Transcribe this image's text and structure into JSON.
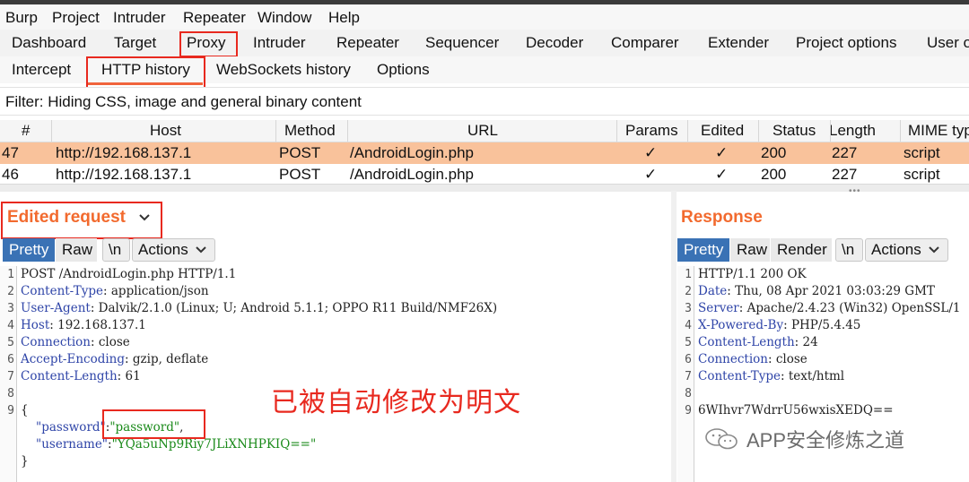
{
  "menubar": {
    "items": [
      "Burp",
      "Project",
      "Intruder",
      "Repeater",
      "Window",
      "Help"
    ]
  },
  "tabs": [
    "Dashboard",
    "Target",
    "Proxy",
    "Intruder",
    "Repeater",
    "Sequencer",
    "Decoder",
    "Comparer",
    "Extender",
    "Project options",
    "User o"
  ],
  "subtabs": [
    "Intercept",
    "HTTP history",
    "WebSockets history",
    "Options"
  ],
  "filter": {
    "text": "Filter: Hiding CSS, image and general binary content"
  },
  "table": {
    "columns": [
      "#",
      "Host",
      "Method",
      "URL",
      "Params",
      "Edited",
      "Status",
      "Length",
      "MIME typ"
    ],
    "rows": [
      {
        "num": "47",
        "host": "http://192.168.137.1",
        "method": "POST",
        "url": "/AndroidLogin.php",
        "params": "✓",
        "edited": "✓",
        "status": "200",
        "length": "227",
        "mime": "script"
      },
      {
        "num": "46",
        "host": "http://192.168.137.1",
        "method": "POST",
        "url": "/AndroidLogin.php",
        "params": "✓",
        "edited": "✓",
        "status": "200",
        "length": "227",
        "mime": "script"
      }
    ]
  },
  "request": {
    "title": "Edited request",
    "buttons": {
      "pretty": "Pretty",
      "raw": "Raw",
      "newline": "\\n",
      "actions": "Actions"
    },
    "line_numbers": [
      "1",
      "2",
      "3",
      "4",
      "5",
      "6",
      "7",
      "8",
      "9"
    ],
    "lines": {
      "l1": "POST /AndroidLogin.php HTTP/1.1",
      "l2_name": "Content-Type",
      "l2_value": " application/json",
      "l3_name": "User-Agent",
      "l3_value": " Dalvik/2.1.0 (Linux; U; Android 5.1.1; OPPO R11 Build/NMF26X)",
      "l4_name": "Host",
      "l4_value": " 192.168.137.1",
      "l5_name": "Connection",
      "l5_value": " close",
      "l6_name": "Accept-Encoding",
      "l6_value": " gzip, deflate",
      "l7_name": "Content-Length",
      "l7_value": " 61",
      "l9": "{",
      "json_key1": "\"password\"",
      "json_val1": "\"password\"",
      "json_key2": "\"username\"",
      "json_val2": "\"YQa5uNp9Riy7JLiXNHPKIQ==\"",
      "close": "}"
    }
  },
  "response": {
    "title": "Response",
    "buttons": {
      "pretty": "Pretty",
      "raw": "Raw",
      "render": "Render",
      "newline": "\\n",
      "actions": "Actions"
    },
    "line_numbers": [
      "1",
      "2",
      "3",
      "4",
      "5",
      "6",
      "7",
      "8",
      "9"
    ],
    "lines": {
      "l1": "HTTP/1.1 200 OK",
      "l2_name": "Date",
      "l2_value": " Thu, 08 Apr 2021 03:03:29 GMT",
      "l3_name": "Server",
      "l3_value": " Apache/2.4.23 (Win32) OpenSSL/1",
      "l4_name": "X-Powered-By",
      "l4_value": " PHP/5.4.45",
      "l5_name": "Content-Length",
      "l5_value": " 24",
      "l6_name": "Connection",
      "l6_value": " close",
      "l7_name": "Content-Type",
      "l7_value": " text/html",
      "l9": "6WIhvr7WdrrU56wxisXEDQ=="
    }
  },
  "annotation": "已被自动修改为明文",
  "watermark": "APP安全修炼之道",
  "colors": {
    "accent": "#f26a2e",
    "selected_row": "#f9c29b",
    "highlight_box": "#e8291f",
    "active_button": "#3a72b5"
  }
}
